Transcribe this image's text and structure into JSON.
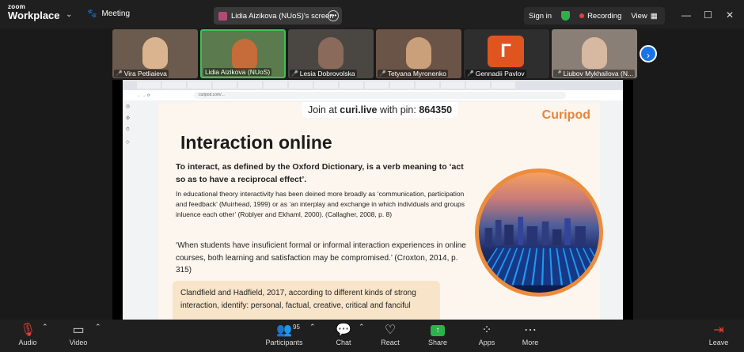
{
  "topbar": {
    "brand_small": "zoom",
    "brand_big": "Workplace",
    "meeting_label": "Meeting",
    "screen_share_label": "Lidia Aizikova (NUoS)'s screen",
    "signin_label": "Sign in",
    "recording_label": "Recording",
    "view_label": "View"
  },
  "participants_strip": [
    {
      "name": "Vira Petliaieva"
    },
    {
      "name": "Lidia Aizikova (NUoS)"
    },
    {
      "name": "Lesia Dobrovolska"
    },
    {
      "name": "Tetyana Myronenko"
    },
    {
      "name": "Gennadii Pavlov",
      "initial": "Г"
    },
    {
      "name": "Liubov Mykhailova (N..."
    }
  ],
  "browser": {
    "url": "curipod.com/..."
  },
  "slide": {
    "join_prefix": "Join at ",
    "join_site": "curi.live",
    "join_mid": " with pin: ",
    "join_pin": "864350",
    "logo_text": "Curipod",
    "title": "Interaction online",
    "p1": "To interact, as defined by the Oxford Dictionary, is a verb meaning to ‘act so as to have a reciprocal effect’.",
    "p2": "In educational theory interactivity has been deined more broadly as ‘communication, participation and feedback’ (Muirhead, 1999) or as ‘an interplay and exchange in which individuals and groups inluence each other’ (Roblyer and Ekhaml, 2000). (Callagher, 2008, p. 8)",
    "p3": "‘When students have insuficient formal or informal interaction experiences in online courses, both learning and satisfaction may be compromised.’ (Croxton, 2014, p. 315)",
    "callout": "Clandfield and Hadfield, 2017, according to different kinds of strong interaction, identify: personal, factual, creative, critical and fanciful"
  },
  "toolbar": {
    "audio": "Audio",
    "video": "Video",
    "participants": "Participants",
    "participants_count": "95",
    "chat": "Chat",
    "react": "React",
    "share": "Share",
    "apps": "Apps",
    "more": "More",
    "leave": "Leave"
  },
  "colors": {
    "accent_green": "#3fc15a",
    "record_red": "#e5403a",
    "curipod_orange": "#e8833a",
    "gennadii_avatar": "#e0541f"
  }
}
